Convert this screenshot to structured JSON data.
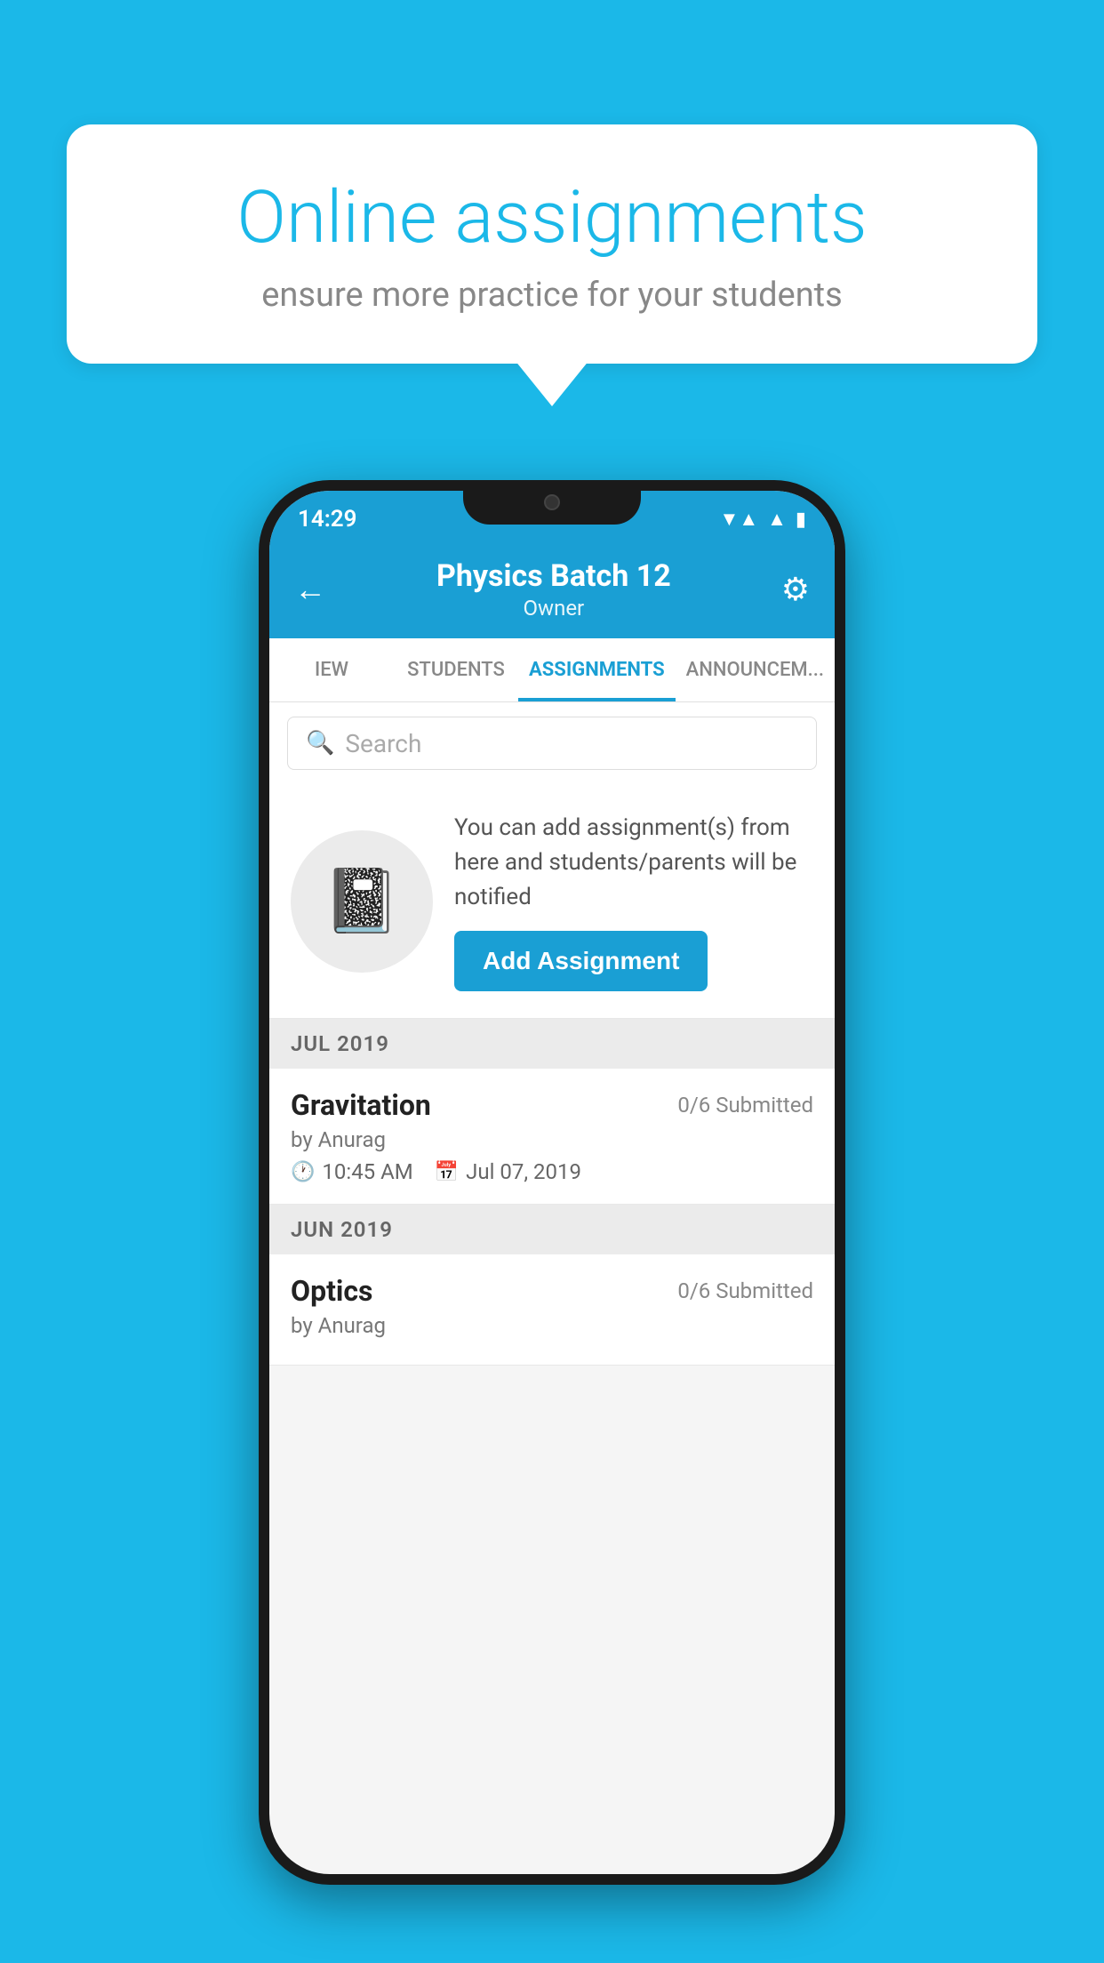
{
  "background": {
    "color": "#1BB8E8"
  },
  "speech_bubble": {
    "title": "Online assignments",
    "subtitle": "ensure more practice for your students"
  },
  "status_bar": {
    "time": "14:29",
    "wifi": "▼▲",
    "battery": "▮"
  },
  "app_header": {
    "title": "Physics Batch 12",
    "subtitle": "Owner",
    "back_label": "←",
    "settings_label": "⚙"
  },
  "tabs": [
    {
      "label": "IEW",
      "active": false
    },
    {
      "label": "STUDENTS",
      "active": false
    },
    {
      "label": "ASSIGNMENTS",
      "active": true
    },
    {
      "label": "ANNOUNCEM...",
      "active": false
    }
  ],
  "search": {
    "placeholder": "Search"
  },
  "add_assignment": {
    "description": "You can add assignment(s) from here and students/parents will be notified",
    "button_label": "Add Assignment"
  },
  "sections": [
    {
      "label": "JUL 2019",
      "assignments": [
        {
          "name": "Gravitation",
          "submitted": "0/6 Submitted",
          "author": "by Anurag",
          "time": "10:45 AM",
          "date": "Jul 07, 2019"
        }
      ]
    },
    {
      "label": "JUN 2019",
      "assignments": [
        {
          "name": "Optics",
          "submitted": "0/6 Submitted",
          "author": "by Anurag",
          "time": "",
          "date": ""
        }
      ]
    }
  ]
}
